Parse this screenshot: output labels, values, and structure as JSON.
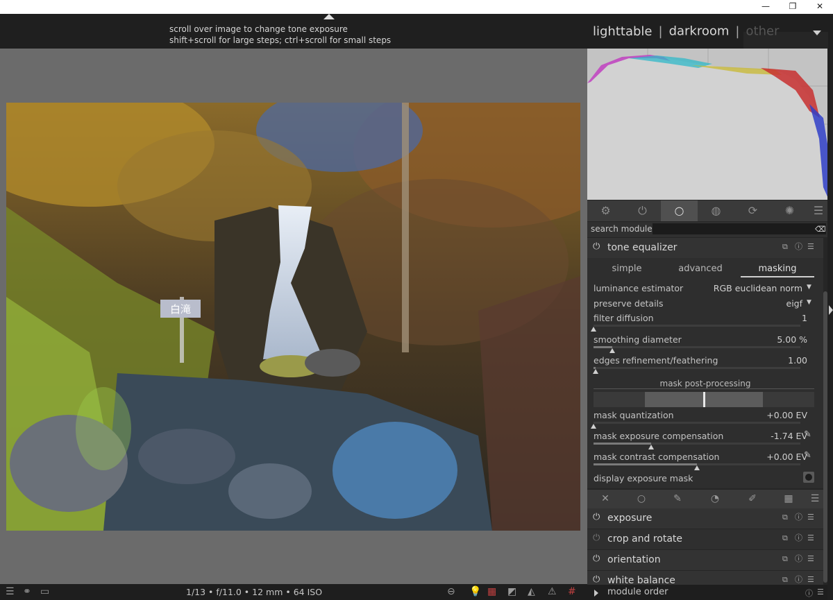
{
  "window": {
    "minimize": "—",
    "restore": "❐",
    "close": "✕"
  },
  "hint": {
    "line1": "scroll over image to change tone exposure",
    "line2": "shift+scroll for large steps; ctrl+scroll for small steps"
  },
  "views": {
    "lighttable": "lighttable",
    "sep": "|",
    "darkroom": "darkroom",
    "other": "other"
  },
  "search": {
    "label": "search module",
    "value": "",
    "placeholder": ""
  },
  "tone_equalizer": {
    "title": "tone equalizer",
    "tabs": [
      "simple",
      "advanced",
      "masking"
    ],
    "active_tab": "masking",
    "params": {
      "luminance_estimator": {
        "label": "luminance estimator",
        "value": "RGB euclidean norm"
      },
      "preserve_details": {
        "label": "preserve details",
        "value": "eigf"
      },
      "filter_diffusion": {
        "label": "filter diffusion",
        "value": "1",
        "slider_fraction": 0.0
      },
      "smoothing_diameter": {
        "label": "smoothing diameter",
        "value": "5.00 %",
        "slider_fraction": 0.09
      },
      "edges_refinement": {
        "label": "edges refinement/feathering",
        "value": "1.00",
        "slider_fraction": 0.01
      },
      "section": "mask post-processing",
      "mask_quantization": {
        "label": "mask quantization",
        "value": "+0.00 EV",
        "slider_fraction": 0.0
      },
      "mask_exposure_comp": {
        "label": "mask exposure compensation",
        "value": "-1.74 EV",
        "slider_fraction": 0.28
      },
      "mask_contrast_comp": {
        "label": "mask contrast compensation",
        "value": "+0.00 EV",
        "slider_fraction": 0.5
      },
      "display_mask": {
        "label": "display exposure mask"
      }
    }
  },
  "modules": [
    {
      "name": "exposure",
      "enabled": true
    },
    {
      "name": "crop and rotate",
      "enabled": false
    },
    {
      "name": "orientation",
      "enabled": true
    },
    {
      "name": "white balance",
      "enabled": true
    }
  ],
  "module_order": "module order",
  "bottom": {
    "exif": "1/13 • f/11.0 • 12 mm • 64 ISO"
  },
  "image": {
    "sign_text": "白滝"
  },
  "icons": {
    "power": "⏻",
    "menu": "☰",
    "info": "ⓘ",
    "copy": "⧉",
    "picker": "✎"
  }
}
